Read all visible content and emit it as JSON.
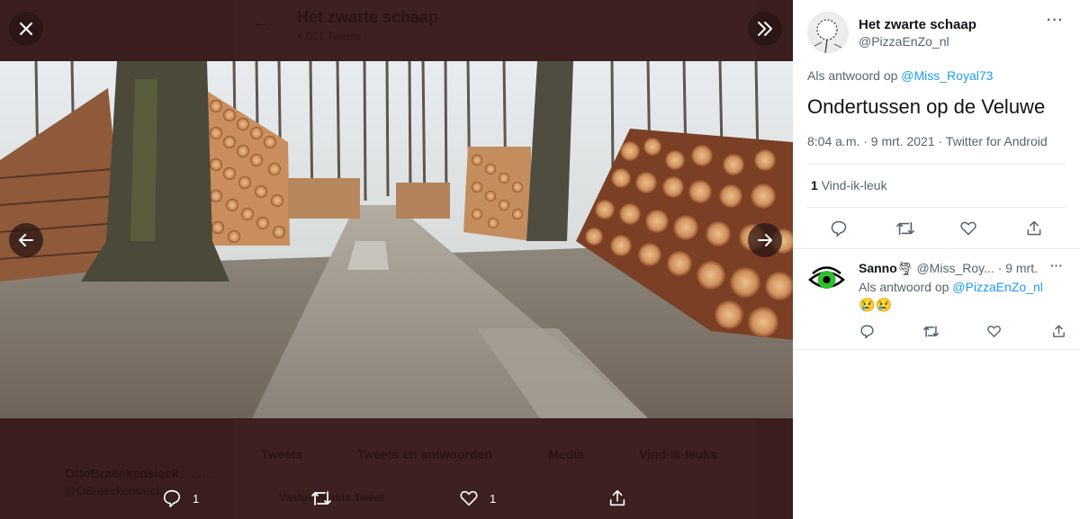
{
  "background_profile": {
    "title": "Het zwarte schaap",
    "tweet_count": "4.001 Tweets",
    "tabs": [
      "Tweets",
      "Tweets en antwoorden",
      "Media",
      "Vind-ik-leuks"
    ],
    "user_name": "OttoBraeckensieck",
    "user_handle": "@OBraeckensieck",
    "pinned_label": "Vastgemaakte Tweet"
  },
  "media_viewer": {
    "reply_count": "1",
    "like_count": "1"
  },
  "tweet": {
    "author_name": "Het zwarte schaap",
    "author_handle": "@PizzaEnZo_nl",
    "reply_prefix": "Als antwoord op ",
    "reply_to": "@Miss_Royal73",
    "text": "Ondertussen op de Veluwe",
    "meta": "8:04 a.m. · 9 mrt. 2021 · Twitter for Android",
    "likes_count": "1",
    "likes_label": "Vind-ik-leuk"
  },
  "reply": {
    "author_name": "Sanno",
    "author_handle": "@Miss_Roy...",
    "time": "· 9 mrt.",
    "reply_prefix": "Als antwoord op ",
    "reply_to": "@PizzaEnZo_nl",
    "text": "😢😢"
  },
  "colors": {
    "accent": "#1d9bf0",
    "overlay": "#3a1e1e"
  }
}
